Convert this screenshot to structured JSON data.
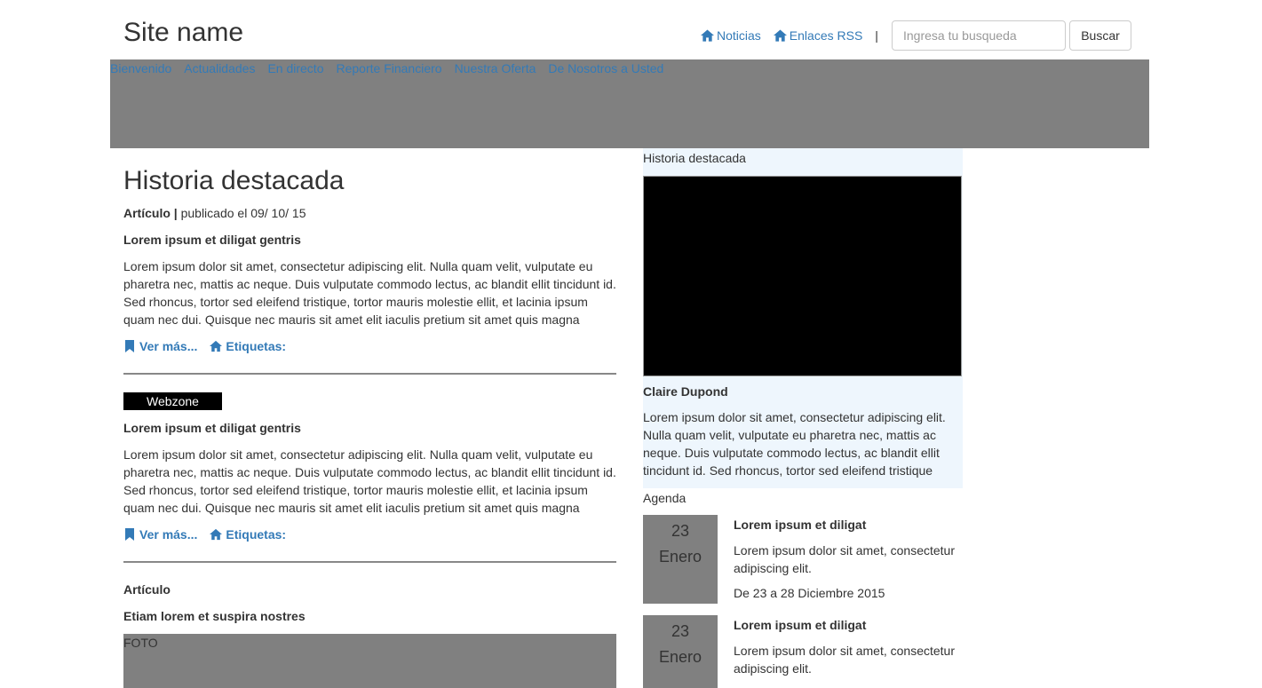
{
  "header": {
    "site_name": "Site name",
    "links": [
      "Noticias",
      "Enlaces RSS"
    ],
    "separator": "|",
    "search_placeholder": "Ingresa tu busqueda",
    "search_button": "Buscar"
  },
  "nav": {
    "items": [
      "Bienvenido",
      "Actualidades",
      "En directo",
      "Reporte Financiero",
      "Nuestra Oferta",
      "De Nosotros a Usted"
    ]
  },
  "main": {
    "title": "Historia destacada",
    "meta_type": "Artículo |",
    "meta_date": " publicado el 09/ 10/ 15",
    "articles": [
      {
        "subtitle": "Lorem ipsum et diligat gentris",
        "body": "Lorem ipsum dolor sit amet, consectetur adipiscing elit. Nulla quam velit, vulputate eu pharetra nec, mattis ac neque. Duis vulputate commodo lectus, ac blandit ellit tincidunt id. Sed rhoncus, tortor sed eleifend tristique, tortor mauris molestie ellit, et lacinia ipsum quam nec dui. Quisque nec mauris sit amet elit iaculis pretium sit amet quis magna",
        "more_label": "Ver más...",
        "tags_label": "Etiquetas:"
      },
      {
        "badge": "Webzone",
        "subtitle": "Lorem ipsum et diligat gentris",
        "body": "Lorem ipsum dolor sit amet, consectetur adipiscing elit. Nulla quam velit, vulputate eu pharetra nec, mattis ac neque. Duis vulputate commodo lectus, ac blandit ellit tincidunt id. Sed rhoncus, tortor sed eleifend tristique, tortor mauris molestie ellit, et lacinia ipsum quam nec dui. Quisque nec mauris sit amet elit iaculis pretium sit amet quis magna",
        "more_label": "Ver más...",
        "tags_label": "Etiquetas:"
      }
    ],
    "third": {
      "type": "Artículo",
      "subtitle": "Etiam lorem et suspira nostres",
      "photo_label": "FOTO"
    }
  },
  "side": {
    "label": "Historia destacada",
    "author": "Claire Dupond",
    "text": "Lorem ipsum dolor sit amet, consectetur adipiscing elit. Nulla quam velit, vulputate eu pharetra nec, mattis ac neque. Duis vulputate commodo lectus, ac blandit ellit tincidunt id. Sed rhoncus, tortor sed eleifend tristique",
    "agenda_label": "Agenda",
    "agenda": [
      {
        "day": "23",
        "month": "Enero",
        "title": "Lorem ipsum et diligat",
        "text": "Lorem ipsum dolor sit amet, consectetur adipiscing elit.",
        "range": "De 23 a 28 Diciembre 2015"
      },
      {
        "day": "23",
        "month": "Enero",
        "title": "Lorem ipsum et diligat",
        "text": "Lorem ipsum dolor sit amet, consectetur adipiscing elit.",
        "range": ""
      }
    ]
  },
  "colors": {
    "link": "#337ab7",
    "banner": "#808080",
    "side_bg": "#eef6fd"
  }
}
